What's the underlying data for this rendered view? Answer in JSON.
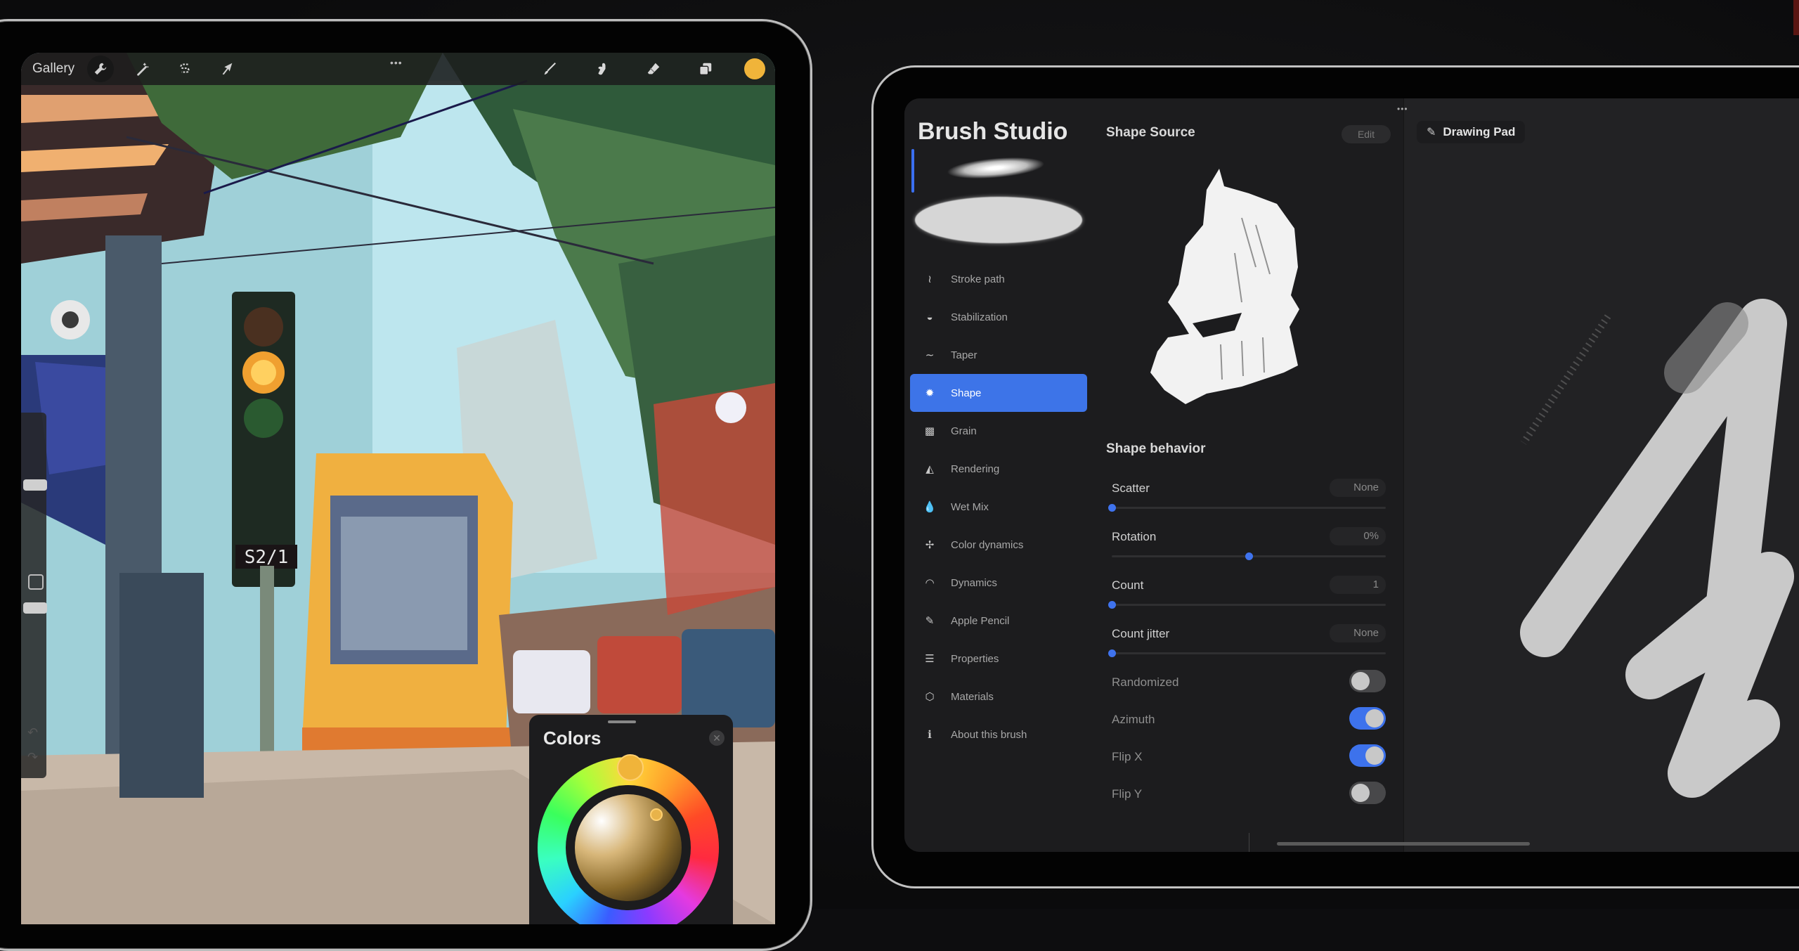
{
  "left_ipad": {
    "toolbar": {
      "gallery_label": "Gallery",
      "left_tools": [
        {
          "name": "actions",
          "icon": "wrench-icon"
        },
        {
          "name": "adjustments",
          "icon": "magic-wand-icon"
        },
        {
          "name": "selection",
          "icon": "selection-s-icon"
        },
        {
          "name": "transform",
          "icon": "arrow-cursor-icon"
        }
      ],
      "more_label": "•••",
      "right_tools": [
        {
          "name": "brush",
          "icon": "paintbrush-icon"
        },
        {
          "name": "smudge",
          "icon": "smudge-finger-icon"
        },
        {
          "name": "eraser",
          "icon": "eraser-icon"
        },
        {
          "name": "layers",
          "icon": "layers-icon"
        }
      ],
      "current_color": "#f0b43a"
    },
    "artwork": {
      "tram_sign": "S2/1"
    },
    "side_panel": {
      "undo_icon": "↶",
      "redo_icon": "↷"
    },
    "colors_panel": {
      "title": "Colors",
      "close_icon": "✕",
      "selected_hue_color": "#f0b43a"
    }
  },
  "right_ipad": {
    "more_label": "•••",
    "brush_studio": {
      "title": "Brush Studio",
      "nav_items": [
        {
          "label": "Stroke path",
          "icon": "stroke-path-icon",
          "glyph": "≀",
          "active": false
        },
        {
          "label": "Stabilization",
          "icon": "stabilization-icon",
          "glyph": "◒",
          "active": false
        },
        {
          "label": "Taper",
          "icon": "taper-icon",
          "glyph": "∼",
          "active": false
        },
        {
          "label": "Shape",
          "icon": "shape-icon",
          "glyph": "✹",
          "active": true
        },
        {
          "label": "Grain",
          "icon": "grain-icon",
          "glyph": "▩",
          "active": false
        },
        {
          "label": "Rendering",
          "icon": "rendering-icon",
          "glyph": "◭",
          "active": false
        },
        {
          "label": "Wet Mix",
          "icon": "drop-icon",
          "glyph": "💧",
          "active": false
        },
        {
          "label": "Color dynamics",
          "icon": "pinwheel-icon",
          "glyph": "✢",
          "active": false
        },
        {
          "label": "Dynamics",
          "icon": "speedometer-icon",
          "glyph": "◠",
          "active": false
        },
        {
          "label": "Apple Pencil",
          "icon": "pencil-circle-icon",
          "glyph": "✎",
          "active": false
        },
        {
          "label": "Properties",
          "icon": "list-icon",
          "glyph": "☰",
          "active": false
        },
        {
          "label": "Materials",
          "icon": "cube-icon",
          "glyph": "⬡",
          "active": false
        },
        {
          "label": "About this brush",
          "icon": "info-icon",
          "glyph": "ℹ",
          "active": false
        }
      ]
    },
    "shape_source": {
      "title": "Shape Source",
      "edit_label": "Edit"
    },
    "shape_behavior": {
      "title": "Shape behavior",
      "sliders": [
        {
          "label": "Scatter",
          "value": "None",
          "fraction": 0.0
        },
        {
          "label": "Rotation",
          "value": "0%",
          "fraction": 0.5
        },
        {
          "label": "Count",
          "value": "1",
          "fraction": 0.0
        },
        {
          "label": "Count jitter",
          "value": "None",
          "fraction": 0.0
        }
      ],
      "toggles": [
        {
          "label": "Randomized",
          "on": false
        },
        {
          "label": "Azimuth",
          "on": true
        },
        {
          "label": "Flip X",
          "on": true
        },
        {
          "label": "Flip Y",
          "on": false
        }
      ]
    },
    "drawing_pad": {
      "label": "Drawing Pad",
      "icon": "edit-square-icon"
    },
    "accent_color": "#3d74e8"
  }
}
